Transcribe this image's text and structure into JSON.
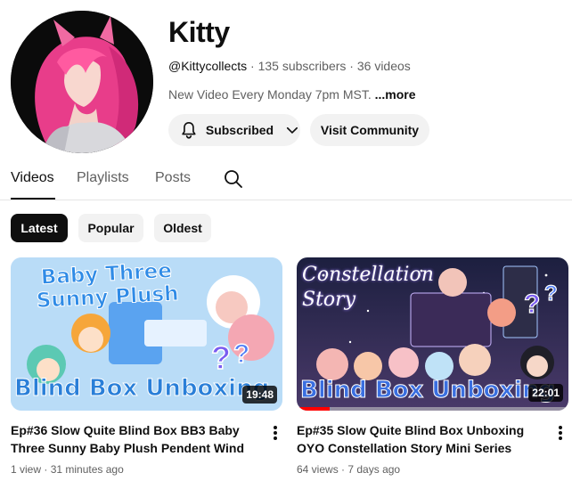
{
  "channel": {
    "name": "Kitty",
    "handle": "@Kittycollects",
    "subscribers": "135 subscribers",
    "videos_count": "36 videos",
    "separator": "·",
    "description": "New Video Every Monday 7pm MST.",
    "more_label": "...more",
    "subscribed_label": "Subscribed",
    "community_label": "Visit Community"
  },
  "tabs": [
    {
      "label": "Videos",
      "active": true
    },
    {
      "label": "Playlists",
      "active": false
    },
    {
      "label": "Posts",
      "active": false
    }
  ],
  "chips": [
    {
      "label": "Latest",
      "active": true
    },
    {
      "label": "Popular",
      "active": false
    },
    {
      "label": "Oldest",
      "active": false
    }
  ],
  "videos": [
    {
      "title": "Ep#36 Slow Quite Blind Box BB3 Baby Three Sunny Baby Plush Pendent Wind Chime…",
      "views": "1 view",
      "age": "31 minutes ago",
      "duration": "19:48",
      "watch_progress": 0,
      "thumb_text_top": "Baby Three Sunny Plush",
      "thumb_text_bottom": "Blind Box Unboxing"
    },
    {
      "title": "Ep#35 Slow Quite Blind Box Unboxing OYO Constellation Story Mini Series Hippers…",
      "views": "64 views",
      "age": "7 days ago",
      "duration": "22:01",
      "watch_progress": 0.12,
      "thumb_text_top": "Constellation Story",
      "thumb_text_bottom": "Blind Box Unboxing"
    }
  ],
  "colors": {
    "accent": "#0f0f0f",
    "muted": "#606060",
    "chip_bg": "#f2f2f2",
    "progress": "#ff0000"
  },
  "icons": {
    "bell": "bell-icon",
    "chevron": "chevron-down-icon",
    "search": "search-icon",
    "more": "more-vert-icon"
  }
}
